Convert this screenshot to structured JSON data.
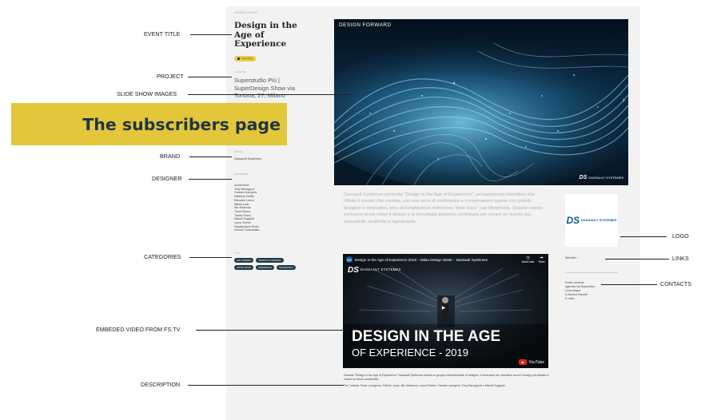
{
  "left": {
    "top_label": "Design event",
    "event_title": "Design in the Age of Experience",
    "status_badge": "Upcoming",
    "project_label": "Location",
    "project": "Superstudio Più | SuperDesign Show via Tortona, 27, Milano",
    "brand_label": "Brand",
    "brand": "Dassault Systèmes",
    "designer_label": "Designers",
    "designers": [
      "Ismail Beck",
      "Tony Barragonè",
      "Carsten Juergens",
      "Matthew Cieffin",
      "Riccardo Lesini",
      "Nikola Lolić",
      "Ilko Mrakovic",
      "Thom Moore",
      "Toshio Shiroi",
      "Masoli Sugiyoki",
      "Laura Teletor",
      "Massimiliano Rossi",
      "Yuhumi Tomomatsu"
    ],
    "categories_label": "Tags",
    "categories": [
      "ART & DESIGN",
      "PRODUCT & INTERIOR",
      "INSTALLATION",
      "EXPERIENCE",
      "TECHNOLOGY"
    ]
  },
  "slideshow": {
    "title": "DESIGN FORWARD",
    "next": "›",
    "logo_mark": "DS",
    "logo_text": "DASSAULT SYSTEMES"
  },
  "intro": "Dassault Systèmes presenta \"Design in the Age of Experience\", un'esperienza interattiva che riflette il mondo che cambia, con una serie di conferenze e conversazioni aperte con grandi designer e innovatori, oltre all'installazione immersiva \"Inter Face\" con Morphosis. Questo evento esclusivo rivela come il design e la tecnologia possono contribuire per creare un mondo più sostenibile, resiliente e rigenerante.",
  "sidebar": {
    "logo_mark": "DS",
    "logo_text": "DASSAULT SYSTEMES",
    "links": "Website ›",
    "contacts": [
      "Press contacts",
      "Agenzia 1st September",
      "Lucia Mayol",
      "& Monica Miscetti",
      "E-mail ›"
    ]
  },
  "video": {
    "channel_mark": "DS",
    "title": "Design in the Age of Experience 2019 – Milan Design Week – Dassault Systèmes",
    "watch_later": "Watch later",
    "share": "Share",
    "brand_mark": "DS",
    "brand_text": "DASSAULT SYSTEMES",
    "play": "▶",
    "headline": "DESIGN IN THE AGE",
    "subline": "OF EXPERIENCE - 2019",
    "yt_play": "▶",
    "yt_label": "YouTube"
  },
  "description": {
    "p1": "Durante \"Design in the Age of Experience\" Dassault Systèmes riunirà un gruppo internazionale di designer e innovatori per discutere come il design può aiutare a creare un futuro sostenibile.",
    "p2": "Tra i relatori: Ross Lovegrove, Patrick Jouin, Ilko Mrakovic, Laura Teletor, Carsten Juergens, Tony Barragonè e Masoli Sugiyoki."
  },
  "callouts": {
    "event_title": "EVENT TITLE",
    "project": "PROJECT",
    "slideshow": "SLIDE SHOW IMAGES",
    "brand": "BRAND",
    "designer": "DESIGNER",
    "categories": "CATEGORIES",
    "video": "EMBEDED VIDEO FROM FS.TV",
    "description": "DESCRIPTION",
    "logo": "LOGO",
    "links": "LINKS",
    "contacts": "CONTACTS"
  },
  "banner": "The subscribers page",
  "colors": {
    "banner_bg": "#e3c63a",
    "banner_text": "#1f3541",
    "chip_bg": "#1f3a48",
    "youtube_red": "#e62117"
  }
}
